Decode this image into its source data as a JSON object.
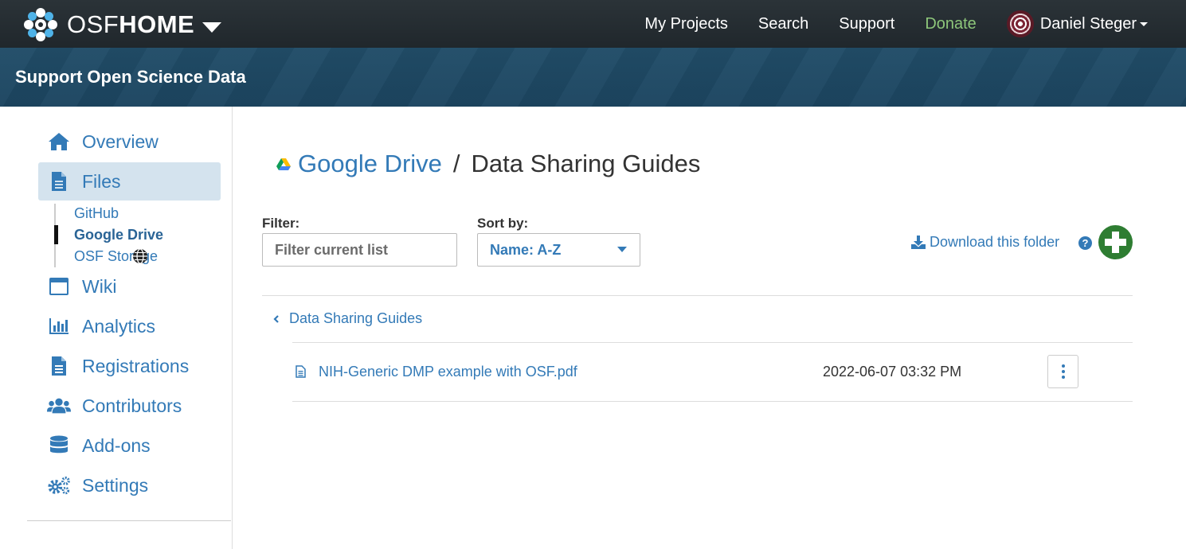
{
  "navbar": {
    "brand_osf": "OSF",
    "brand_home": "HOME",
    "links": [
      "My Projects",
      "Search",
      "Support",
      "Donate"
    ],
    "user_name": "Daniel Steger"
  },
  "project": {
    "title": "Support Open Science Data"
  },
  "sidebar": {
    "items": [
      {
        "label": "Overview",
        "icon": "home-icon"
      },
      {
        "label": "Files",
        "icon": "file-icon"
      },
      {
        "label": "Wiki",
        "icon": "wiki-icon"
      },
      {
        "label": "Analytics",
        "icon": "bar-chart-icon"
      },
      {
        "label": "Registrations",
        "icon": "file-icon"
      },
      {
        "label": "Contributors",
        "icon": "users-icon"
      },
      {
        "label": "Add-ons",
        "icon": "database-icon"
      },
      {
        "label": "Settings",
        "icon": "gears-icon"
      }
    ],
    "storage": [
      "GitHub",
      "Google Drive",
      "OSF Storage"
    ]
  },
  "breadcrumb": {
    "provider": "Google Drive",
    "separator": "/",
    "folder": "Data Sharing Guides"
  },
  "controls": {
    "filter_label": "Filter:",
    "filter_placeholder": "Filter current list",
    "sort_label": "Sort by:",
    "sort_value": "Name: A-Z",
    "download_label": "Download this folder",
    "help_glyph": "?"
  },
  "listing": {
    "parent_folder": "Data Sharing Guides",
    "files": [
      {
        "name": "NIH-Generic DMP example with OSF.pdf",
        "modified": "2022-06-07 03:32 PM"
      }
    ]
  },
  "colors": {
    "link": "#337ab7",
    "donate": "#8dc67a",
    "add": "#2e7d32",
    "banner": "#1f4a63"
  }
}
